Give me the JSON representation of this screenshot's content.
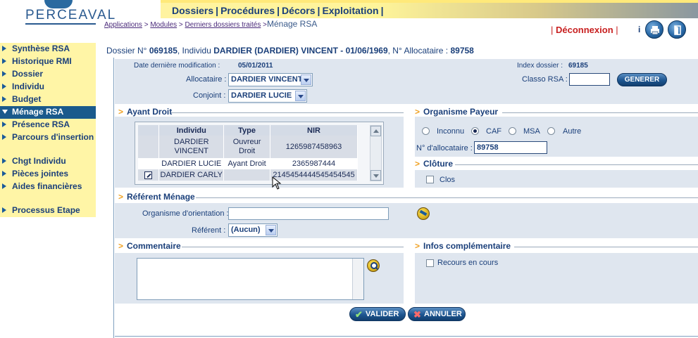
{
  "logo": {
    "text": "PERCEAVAL"
  },
  "topnav": [
    "Dossiers",
    "Procédures",
    "Décors",
    "Exploitation"
  ],
  "breadcrumb": {
    "links": [
      "Applications",
      "Modules",
      "Derniers dossiers traités"
    ],
    "current": "Ménage RSA"
  },
  "header": {
    "logout_label": "Déconnexion",
    "info_label": "i"
  },
  "icons": {
    "print": "printer-icon",
    "exit": "door-exit-icon"
  },
  "sidebar": {
    "items": [
      {
        "label": "Synthèse RSA"
      },
      {
        "label": "Historique RMI"
      },
      {
        "label": "Dossier"
      },
      {
        "label": "Individu"
      },
      {
        "label": "Budget"
      },
      {
        "label": "Ménage RSA",
        "active": true
      },
      {
        "label": "Présence RSA"
      },
      {
        "label": "Parcours d'insertion"
      },
      {
        "label": "Chgt Individu"
      },
      {
        "label": "Pièces jointes"
      },
      {
        "label": "Aides financières"
      },
      {
        "label": "Processus Etape"
      }
    ]
  },
  "dossier_title": {
    "prefix": "Dossier N°",
    "dossier_no": "069185",
    "individu_label": ", Individu",
    "individu": "DARDIER (DARDIER) VINCENT - 01/06/1969",
    "allocataire_label": ", N° Allocataire :",
    "allocataire_no": "89758"
  },
  "info": {
    "date_label": "Date dernière modification :",
    "date_value": "05/01/2011",
    "index_label": "Index dossier :",
    "index_value": "69185",
    "allocataire_label": "Allocataire :",
    "allocataire_value": "DARDIER VINCENT",
    "classo_label": "Classo RSA :",
    "classo_value": "",
    "generer_label": "GENERER",
    "conjoint_label": "Conjoint :",
    "conjoint_value": "DARDIER LUCIE"
  },
  "ayant_droit": {
    "title": "Ayant Droit",
    "columns": [
      "Individu",
      "Type",
      "NIR"
    ],
    "rows": [
      {
        "individu": "DARDIER VINCENT",
        "type": "Ouvreur Droit",
        "nir": "1265987458963"
      },
      {
        "individu": "DARDIER LUCIE",
        "type": "Ayant Droit",
        "nir": "2365987444"
      },
      {
        "individu": "DARDIER CARLY",
        "type": "",
        "nir": "2145454444545454545"
      }
    ]
  },
  "organisme_payeur": {
    "title": "Organisme Payeur",
    "options": [
      "Inconnu",
      "CAF",
      "MSA",
      "Autre"
    ],
    "selected": "CAF",
    "alloc_label": "N° d'allocataire :",
    "alloc_value": "89758"
  },
  "cloture": {
    "title": "Clôture",
    "clos_label": "Clos"
  },
  "referent": {
    "title": "Référent Ménage",
    "orientation_label": "Organisme d'orientation :",
    "orientation_value": "",
    "referent_label": "Référent :",
    "referent_value": "(Aucun)"
  },
  "commentaire": {
    "title": "Commentaire",
    "value": ""
  },
  "infos_comp": {
    "title": "Infos complémentaire",
    "recours_label": "Recours en cours"
  },
  "actions": {
    "valider": "VALIDER",
    "annuler": "ANNULER"
  },
  "colors": {
    "accent": "#1a5a8c",
    "sidebar_bg": "#fff5a6",
    "logout": "#c82020",
    "band": "#dfe6ef"
  }
}
